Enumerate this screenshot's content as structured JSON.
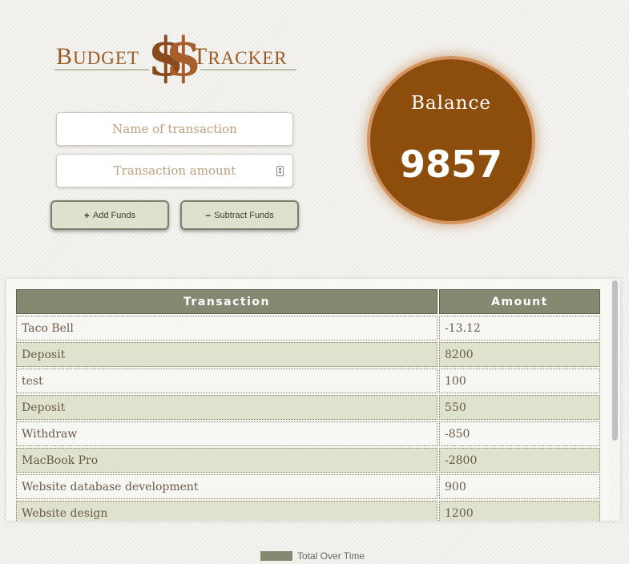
{
  "logo": {
    "word1_first": "B",
    "word1_rest": "UDGET",
    "dollar": "$",
    "word2_first": "T",
    "word2_rest": "RACKER"
  },
  "form": {
    "name_placeholder": "Name of transaction",
    "amount_placeholder": "Transaction amount",
    "add_label": "Add Funds",
    "add_icon": "+",
    "subtract_label": "Subtract Funds",
    "subtract_icon": "−"
  },
  "balance": {
    "label": "Balance",
    "value": "9857"
  },
  "table": {
    "headers": [
      "Transaction",
      "Amount"
    ],
    "rows": [
      {
        "name": "Taco Bell",
        "amount": "-13.12"
      },
      {
        "name": "Deposit",
        "amount": "8200"
      },
      {
        "name": "test",
        "amount": "100"
      },
      {
        "name": "Deposit",
        "amount": "550"
      },
      {
        "name": "Withdraw",
        "amount": "-850"
      },
      {
        "name": "MacBook Pro",
        "amount": "-2800"
      },
      {
        "name": "Website database development",
        "amount": "900"
      },
      {
        "name": "Website design",
        "amount": "1200"
      }
    ]
  },
  "chart": {
    "legend_label": "Total Over Time",
    "series_color": "#868872"
  },
  "colors": {
    "brand_brown": "#8c4d0d",
    "accent_olive": "#868872",
    "row_alt": "#dfe2cc"
  }
}
